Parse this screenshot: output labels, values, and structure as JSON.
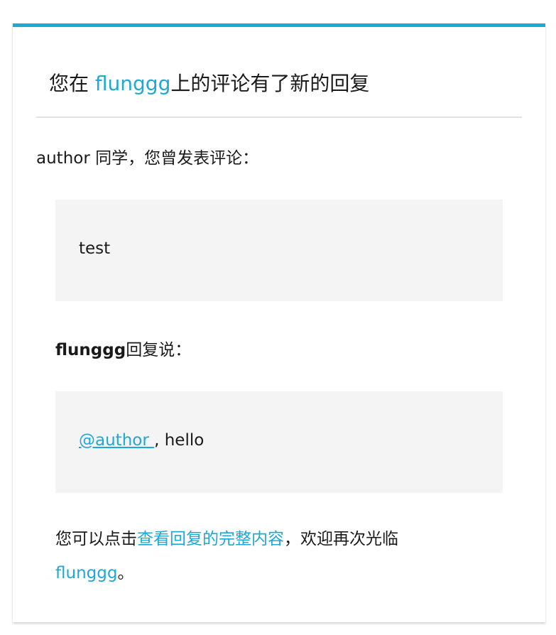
{
  "header": {
    "prefix": "您在 ",
    "site_link": "flunggg",
    "suffix": "上的评论有了新的回复"
  },
  "greeting": "author 同学，您曾发表评论：",
  "original_comment": "test",
  "reply": {
    "author": "flunggg",
    "label_suffix": "回复说：",
    "mention": "@author ",
    "text": ", hello"
  },
  "footer": {
    "prefix": "您可以点击",
    "view_link": "查看回复的完整内容",
    "middle": "，欢迎再次光临",
    "site_link": "flunggg",
    "end": "。"
  },
  "colors": {
    "accent": "#1fa8d3",
    "quote_bg": "#f4f4f4"
  }
}
